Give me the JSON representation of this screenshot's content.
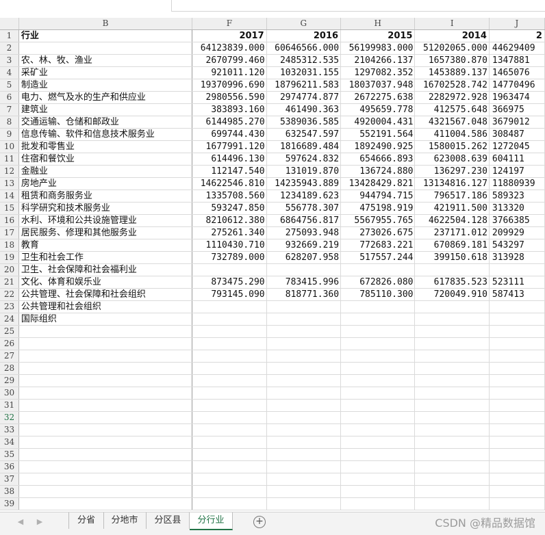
{
  "columns": [
    "B",
    "F",
    "G",
    "H",
    "I",
    "J"
  ],
  "header_row": {
    "label": "行业",
    "years": [
      "2017",
      "2016",
      "2015",
      "2014",
      "2"
    ]
  },
  "rows": [
    {
      "n": "2",
      "label": "",
      "vals": [
        "64123839.000",
        "60646566.000",
        "56199983.000",
        "51202065.000",
        "44629409"
      ]
    },
    {
      "n": "3",
      "label": "农、林、牧、渔业",
      "vals": [
        "2670799.460",
        "2485312.535",
        "2104266.137",
        "1657380.870",
        "1347881"
      ]
    },
    {
      "n": "4",
      "label": "采矿业",
      "vals": [
        "921011.120",
        "1032031.155",
        "1297082.352",
        "1453889.137",
        "1465076"
      ]
    },
    {
      "n": "5",
      "label": "制造业",
      "vals": [
        "19370996.690",
        "18796211.583",
        "18037037.948",
        "16702528.742",
        "14770496"
      ]
    },
    {
      "n": "6",
      "label": "电力、燃气及水的生产和供应业",
      "vals": [
        "2980556.590",
        "2974774.877",
        "2672275.638",
        "2282972.928",
        "1963474"
      ]
    },
    {
      "n": "7",
      "label": "建筑业",
      "vals": [
        "383893.160",
        "461490.363",
        "495659.778",
        "412575.648",
        "366975"
      ]
    },
    {
      "n": "8",
      "label": "交通运输、仓储和邮政业",
      "vals": [
        "6144985.270",
        "5389036.585",
        "4920004.431",
        "4321567.048",
        "3679012"
      ]
    },
    {
      "n": "9",
      "label": "信息传输、软件和信息技术服务业",
      "vals": [
        "699744.430",
        "632547.597",
        "552191.564",
        "411004.586",
        "308487"
      ]
    },
    {
      "n": "10",
      "label": "批发和零售业",
      "vals": [
        "1677991.120",
        "1816689.484",
        "1892490.925",
        "1580015.262",
        "1272045"
      ]
    },
    {
      "n": "11",
      "label": "住宿和餐饮业",
      "vals": [
        "614496.130",
        "597624.832",
        "654666.893",
        "623008.639",
        "604111"
      ]
    },
    {
      "n": "12",
      "label": "金融业",
      "vals": [
        "112147.540",
        "131019.870",
        "136724.880",
        "136297.230",
        "124197"
      ]
    },
    {
      "n": "13",
      "label": "房地产业",
      "vals": [
        "14622546.810",
        "14235943.889",
        "13428429.821",
        "13134816.127",
        "11880939"
      ]
    },
    {
      "n": "14",
      "label": "租赁和商务服务业",
      "vals": [
        "1335708.560",
        "1234189.623",
        "944794.715",
        "796517.186",
        "589323"
      ]
    },
    {
      "n": "15",
      "label": "科学研究和技术服务业",
      "vals": [
        "593247.850",
        "556778.307",
        "475198.919",
        "421911.500",
        "313320"
      ]
    },
    {
      "n": "16",
      "label": "水利、环境和公共设施管理业",
      "vals": [
        "8210612.380",
        "6864756.817",
        "5567955.765",
        "4622504.128",
        "3766385"
      ]
    },
    {
      "n": "17",
      "label": "居民服务、修理和其他服务业",
      "vals": [
        "275261.340",
        "275093.948",
        "273026.675",
        "237171.012",
        "209929"
      ]
    },
    {
      "n": "18",
      "label": "教育",
      "vals": [
        "1110430.710",
        "932669.219",
        "772683.221",
        "670869.181",
        "543297"
      ]
    },
    {
      "n": "19",
      "label": "卫生和社会工作",
      "vals": [
        "732789.000",
        "628207.958",
        "517557.244",
        "399150.618",
        "313928"
      ]
    },
    {
      "n": "20",
      "label": "卫生、社会保障和社会福利业",
      "vals": [
        "",
        "",
        "",
        "",
        ""
      ]
    },
    {
      "n": "21",
      "label": "文化、体育和娱乐业",
      "vals": [
        "873475.290",
        "783415.996",
        "672826.080",
        "617835.523",
        "523111"
      ]
    },
    {
      "n": "22",
      "label": "公共管理、社会保障和社会组织",
      "vals": [
        "793145.090",
        "818771.360",
        "785110.300",
        "720049.910",
        "587413"
      ]
    },
    {
      "n": "23",
      "label": "公共管理和社会组织",
      "vals": [
        "",
        "",
        "",
        "",
        ""
      ]
    },
    {
      "n": "24",
      "label": "国际组织",
      "vals": [
        "",
        "",
        "",
        "",
        ""
      ]
    }
  ],
  "empty_rows": [
    "25",
    "26",
    "27",
    "28",
    "29",
    "30",
    "31",
    "32",
    "33",
    "34",
    "35",
    "36",
    "37",
    "38",
    "39"
  ],
  "active_row": "32",
  "tabs": [
    "分省",
    "分地市",
    "分区县",
    "分行业"
  ],
  "active_tab": "分行业",
  "add_sheet_glyph": "+",
  "nav_glyphs": [
    "◀",
    "▶"
  ],
  "watermark": "CSDN @精品数据馆",
  "accent_color": "#217346"
}
